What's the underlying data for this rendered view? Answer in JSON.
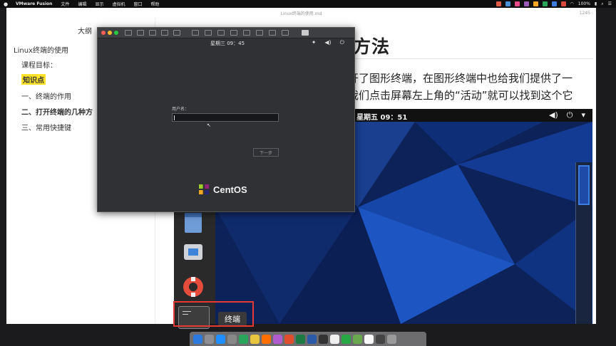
{
  "menubar": {
    "app_name": "VMware Fusion",
    "items": [
      "文件",
      "编辑",
      "显示",
      "虚拟机",
      "窗口",
      "帮助"
    ],
    "battery": "100%",
    "battery_glyph": "▮",
    "wifi_glyph": "◠",
    "apple_glyph": "●",
    "search_glyph": "⌕",
    "bars_glyph": "☰",
    "apple_icon": "apple-icon",
    "status_colors": [
      "#d9473d",
      "#3e7be0",
      "#2aa55c",
      "#f5a623",
      "#9b59b6",
      "#e94b8a",
      "#4a90d9",
      "#e05a47"
    ]
  },
  "doc": {
    "filename": "Linux终端的使用.md",
    "word_count": "1245",
    "outline_title": "大纲",
    "toc": [
      "Linux终端的使用",
      "课程目标：",
      "知识点",
      "一、终端的作用",
      "二、打开终端的几种方",
      "三、常用快捷键"
    ],
    "heading": "方法",
    "para_1": "开了图形终端，在图形终端中也给我们提供了一",
    "para_2": "我们点击屏幕左上角的“活动”就可以找到这个它"
  },
  "gnome": {
    "clock": "星期五 09：51",
    "search_placeholder": "...",
    "tooltip": "终端",
    "volume_glyph": "◀)",
    "power_glyph": "⏻",
    "arrow_glyph": "▾"
  },
  "vm": {
    "clock": "星期三 09：45",
    "username_label": "用户名：",
    "next_button": "下一步",
    "brand": "CentOS",
    "icon_a": "✦",
    "icon_vol": "◀)",
    "icon_power": "⏻",
    "cursor_glyph": "↖"
  }
}
